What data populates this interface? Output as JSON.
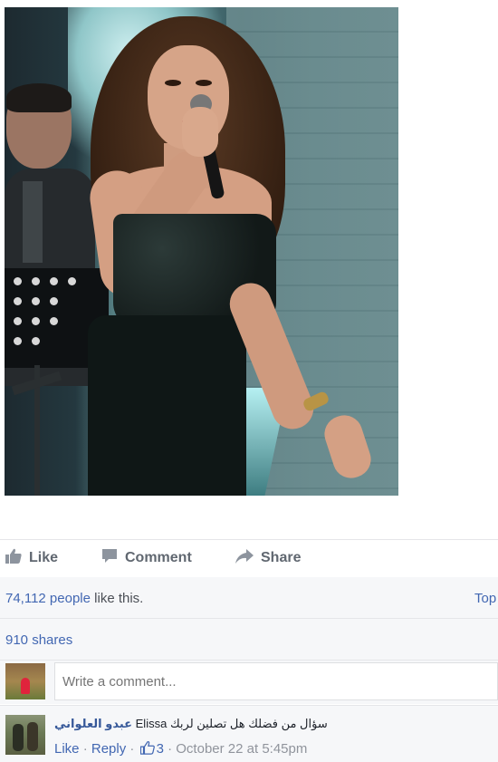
{
  "post": {
    "photo_alt": "photo"
  },
  "actions": {
    "like": "Like",
    "comment": "Comment",
    "share": "Share"
  },
  "reactions": {
    "count": "74,112 people",
    "suffix": " like this.",
    "top_label": "Top"
  },
  "shares": {
    "text": "910 shares"
  },
  "composer": {
    "placeholder": "Write a comment..."
  },
  "comments": [
    {
      "author": "عبدو العلواني",
      "tag": "Elissa",
      "body": "سؤال من فضلك هل تصلين لربك",
      "like_label": "Like",
      "reply_label": "Reply",
      "like_count": "3",
      "timestamp": "October 22 at 5:45pm"
    }
  ],
  "colors": {
    "link": "#4267b2",
    "muted": "#90949c",
    "row_bg": "#f6f7f9"
  },
  "icons": [
    "thumbs-up-icon",
    "comment-bubble-icon",
    "share-arrow-icon"
  ]
}
